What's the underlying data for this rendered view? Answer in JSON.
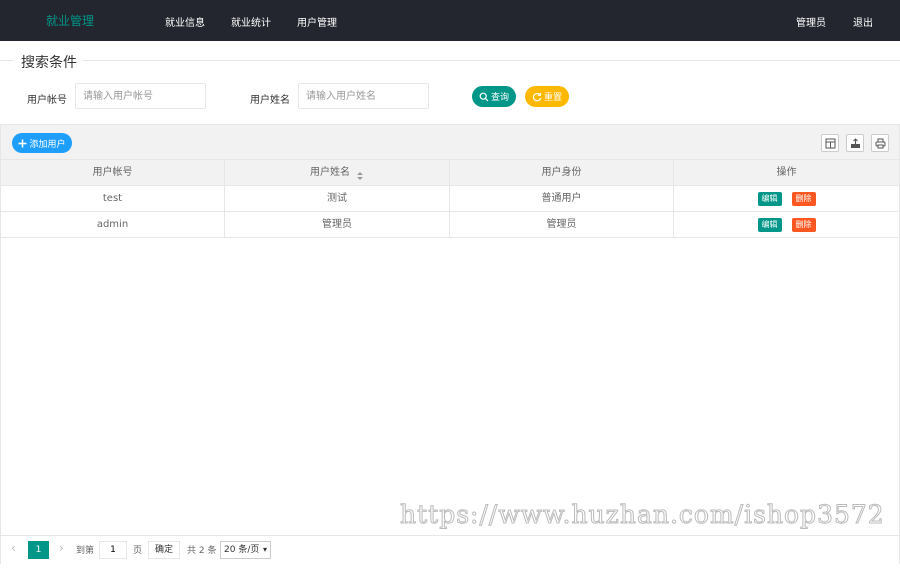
{
  "header": {
    "brand": "就业管理",
    "nav": [
      "就业信息",
      "就业统计",
      "用户管理"
    ],
    "user": "管理员",
    "logout": "退出"
  },
  "search": {
    "legend": "搜索条件",
    "account_label": "用户帐号",
    "account_placeholder": "请输入用户帐号",
    "name_label": "用户姓名",
    "name_placeholder": "请输入用户姓名",
    "search_btn": "查询",
    "reset_btn": "重置"
  },
  "toolbar": {
    "add_btn": "添加用户",
    "icons": [
      "columns-icon",
      "export-icon",
      "print-icon"
    ]
  },
  "table": {
    "columns": [
      "用户帐号",
      "用户姓名",
      "用户身份",
      "操作"
    ],
    "rows": [
      {
        "account": "test",
        "name": "测试",
        "role": "普通用户",
        "edit": "编辑",
        "delete": "删除"
      },
      {
        "account": "admin",
        "name": "管理员",
        "role": "管理员",
        "edit": "编辑",
        "delete": "删除"
      }
    ]
  },
  "pagination": {
    "current": "1",
    "goto_label": "到第",
    "goto_value": "1",
    "page_unit": "页",
    "confirm": "确定",
    "total": "共 2 条",
    "page_size": "20 条/页"
  },
  "watermark": "https://www.huzhan.com/ishop3572",
  "colors": {
    "header_bg": "#23262e",
    "brand": "#009688",
    "search": "#009688",
    "reset": "#ffb800",
    "add": "#1e9fff",
    "delete": "#ff5722"
  }
}
